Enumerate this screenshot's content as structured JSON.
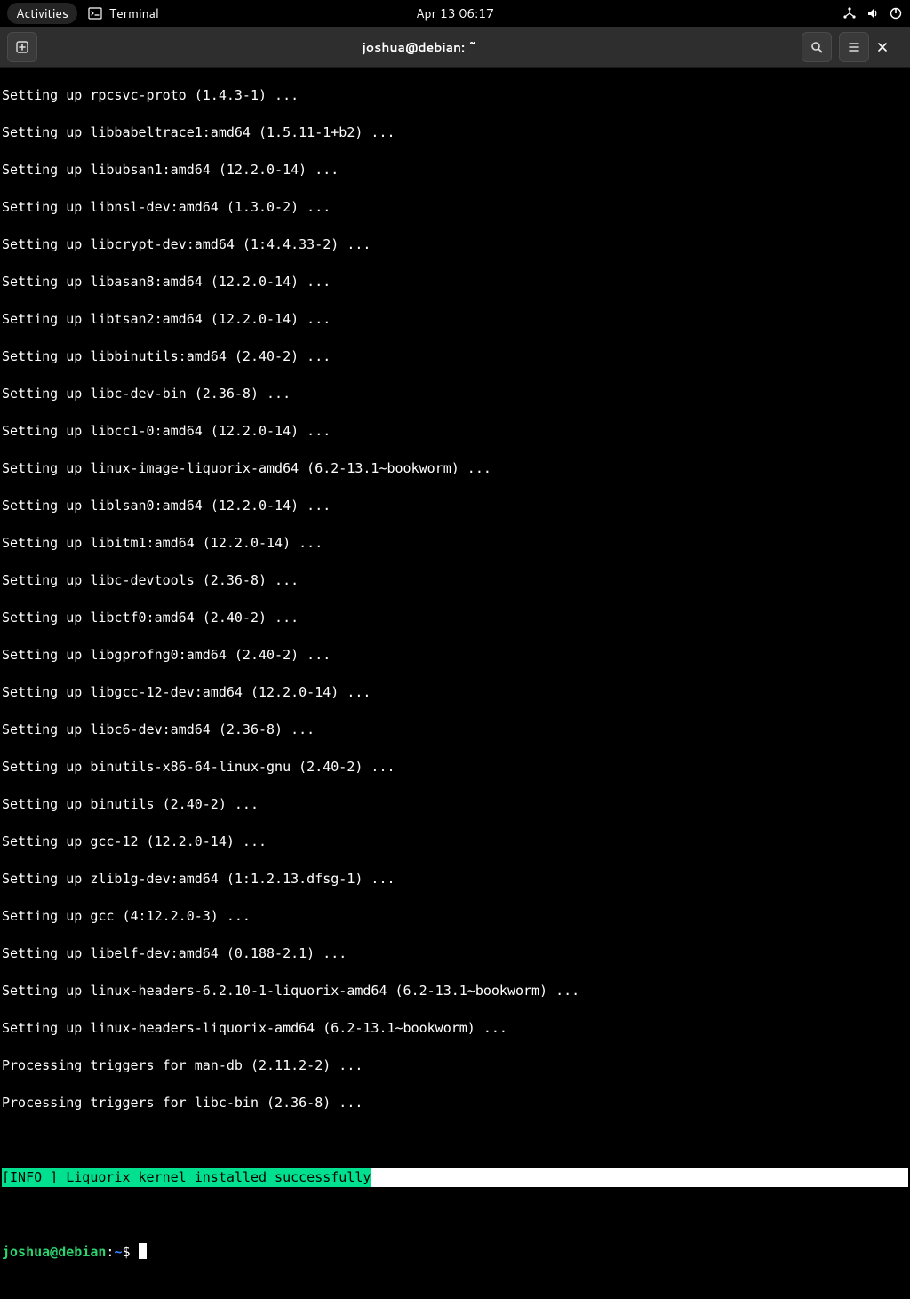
{
  "topbar": {
    "activities": "Activities",
    "app_name": "Terminal",
    "datetime": "Apr 13  06:17"
  },
  "titlebar": {
    "title": "joshua@debian: ~"
  },
  "terminal": {
    "lines": [
      "Setting up rpcsvc-proto (1.4.3-1) ...",
      "Setting up libbabeltrace1:amd64 (1.5.11-1+b2) ...",
      "Setting up libubsan1:amd64 (12.2.0-14) ...",
      "Setting up libnsl-dev:amd64 (1.3.0-2) ...",
      "Setting up libcrypt-dev:amd64 (1:4.4.33-2) ...",
      "Setting up libasan8:amd64 (12.2.0-14) ...",
      "Setting up libtsan2:amd64 (12.2.0-14) ...",
      "Setting up libbinutils:amd64 (2.40-2) ...",
      "Setting up libc-dev-bin (2.36-8) ...",
      "Setting up libcc1-0:amd64 (12.2.0-14) ...",
      "Setting up linux-image-liquorix-amd64 (6.2-13.1~bookworm) ...",
      "Setting up liblsan0:amd64 (12.2.0-14) ...",
      "Setting up libitm1:amd64 (12.2.0-14) ...",
      "Setting up libc-devtools (2.36-8) ...",
      "Setting up libctf0:amd64 (2.40-2) ...",
      "Setting up libgprofng0:amd64 (2.40-2) ...",
      "Setting up libgcc-12-dev:amd64 (12.2.0-14) ...",
      "Setting up libc6-dev:amd64 (2.36-8) ...",
      "Setting up binutils-x86-64-linux-gnu (2.40-2) ...",
      "Setting up binutils (2.40-2) ...",
      "Setting up gcc-12 (12.2.0-14) ...",
      "Setting up zlib1g-dev:amd64 (1:1.2.13.dfsg-1) ...",
      "Setting up gcc (4:12.2.0-3) ...",
      "Setting up libelf-dev:amd64 (0.188-2.1) ...",
      "Setting up linux-headers-6.2.10-1-liquorix-amd64 (6.2-13.1~bookworm) ...",
      "Setting up linux-headers-liquorix-amd64 (6.2-13.1~bookworm) ...",
      "Processing triggers for man-db (2.11.2-2) ...",
      "Processing triggers for libc-bin (2.36-8) ..."
    ],
    "info_msg": "[INFO ] Liquorix kernel installed successfully",
    "prompt": {
      "user_host": "joshua@debian",
      "sep": ":",
      "path": "~",
      "symbol": "$ "
    }
  }
}
